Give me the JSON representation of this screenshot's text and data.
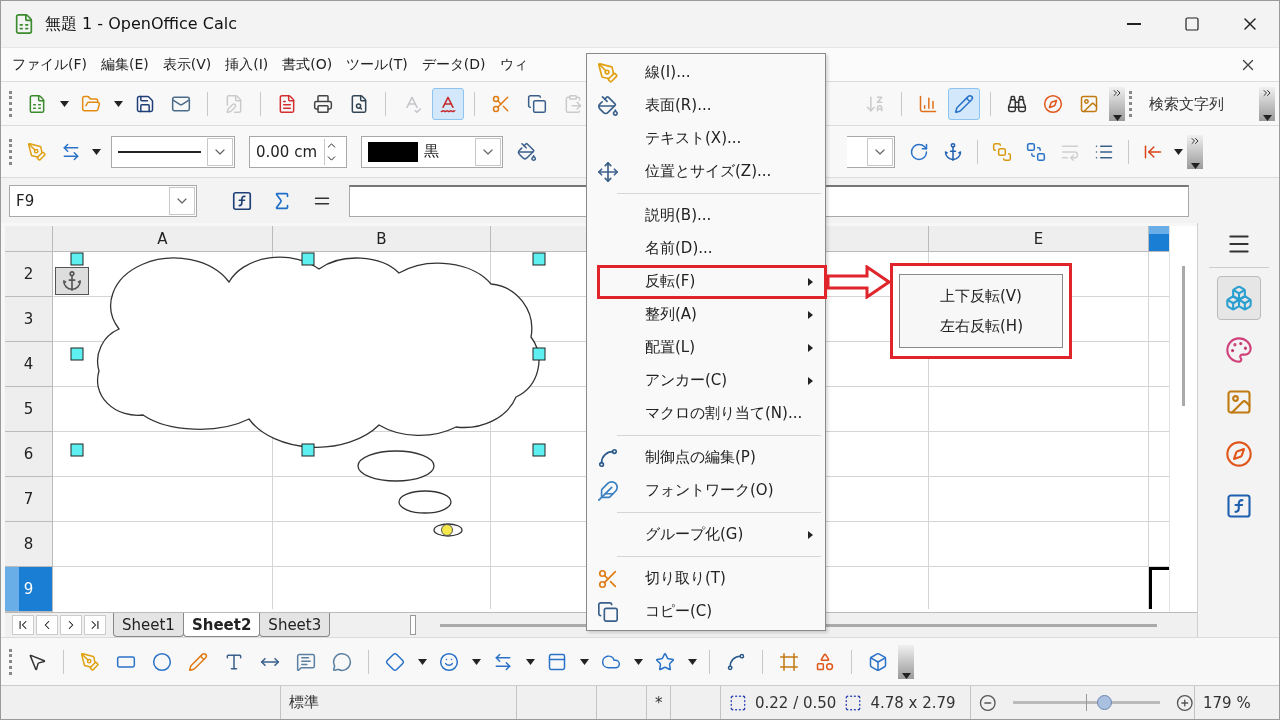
{
  "window": {
    "title": "無題 1 - OpenOffice Calc"
  },
  "menu_bar": [
    "ファイル(F)",
    "編集(E)",
    "表示(V)",
    "挿入(I)",
    "書式(O)",
    "ツール(T)",
    "データ(D)",
    "ウィ"
  ],
  "standard_toolbar": {
    "left": [
      {
        "kind": "new",
        "menu": true,
        "disabled": false,
        "selected": false
      },
      {
        "kind": "open",
        "menu": true,
        "disabled": false,
        "selected": false
      },
      {
        "kind": "save",
        "menu": false,
        "disabled": false,
        "selected": false
      },
      {
        "kind": "email",
        "menu": false,
        "disabled": false,
        "selected": false
      },
      {
        "kind": "separator"
      },
      {
        "kind": "edit",
        "menu": false,
        "disabled": true,
        "selected": false
      },
      {
        "kind": "separator"
      },
      {
        "kind": "pdf",
        "menu": false,
        "disabled": false,
        "selected": false
      },
      {
        "kind": "print",
        "menu": false,
        "disabled": false,
        "selected": false
      },
      {
        "kind": "preview",
        "menu": false,
        "disabled": false,
        "selected": false
      },
      {
        "kind": "separator"
      },
      {
        "kind": "spelling",
        "menu": false,
        "disabled": true,
        "selected": false
      },
      {
        "kind": "autospell",
        "menu": false,
        "disabled": false,
        "selected": true
      },
      {
        "kind": "separator"
      },
      {
        "kind": "cut",
        "menu": false,
        "disabled": false,
        "selected": false
      },
      {
        "kind": "copy",
        "menu": false,
        "disabled": false,
        "selected": false
      },
      {
        "kind": "paste",
        "menu": false,
        "disabled": true,
        "selected": false
      }
    ],
    "right": [
      {
        "kind": "sort",
        "menu": false,
        "disabled": true,
        "selected": false
      },
      {
        "kind": "separator"
      },
      {
        "kind": "chart",
        "menu": false,
        "disabled": false,
        "selected": false
      },
      {
        "kind": "draw",
        "menu": false,
        "disabled": false,
        "selected": true
      },
      {
        "kind": "separator"
      },
      {
        "kind": "find",
        "menu": false,
        "disabled": false,
        "selected": false
      },
      {
        "kind": "navigator",
        "menu": false,
        "disabled": false,
        "selected": false
      },
      {
        "kind": "gallery",
        "menu": false,
        "disabled": false,
        "selected": false
      },
      {
        "kind": "overflow"
      }
    ],
    "search": {
      "placeholder": "検索文字列"
    }
  },
  "format_toolbar": {
    "left": [
      {
        "kind": "line",
        "menu": false,
        "disabled": false
      },
      {
        "kind": "arrow-style",
        "menu": true,
        "disabled": false
      },
      {
        "kind": "line-style-select"
      },
      {
        "kind": "width-spin",
        "value": "0.00 cm"
      },
      {
        "kind": "color-select",
        "color": "#000000",
        "label": "黒"
      },
      {
        "kind": "area",
        "menu": false,
        "disabled": false
      }
    ],
    "right": [
      {
        "kind": "select-tail"
      },
      {
        "kind": "rotate",
        "menu": false,
        "disabled": false
      },
      {
        "kind": "anchor",
        "menu": false,
        "disabled": false
      },
      {
        "kind": "separator"
      },
      {
        "kind": "front",
        "menu": false,
        "disabled": false
      },
      {
        "kind": "back",
        "menu": false,
        "disabled": false
      },
      {
        "kind": "wrap-off",
        "menu": false,
        "disabled": true
      },
      {
        "kind": "wrap",
        "menu": false,
        "disabled": false
      },
      {
        "kind": "separator"
      },
      {
        "kind": "align",
        "menu": true,
        "disabled": false
      },
      {
        "kind": "overflow"
      }
    ]
  },
  "formula_bar": {
    "name_box": "F9"
  },
  "sheet": {
    "columns": [
      {
        "label": "A",
        "selected": false
      },
      {
        "label": "B",
        "selected": false
      },
      {
        "selected": false
      },
      {
        "selected": false
      },
      {
        "label": "E",
        "selected": false
      },
      {
        "selected": true
      }
    ],
    "rows": [
      {
        "label": "2",
        "selected": false
      },
      {
        "label": "3",
        "selected": false
      },
      {
        "label": "4",
        "selected": false
      },
      {
        "label": "5",
        "selected": false
      },
      {
        "label": "6",
        "selected": false
      },
      {
        "label": "7",
        "selected": false
      },
      {
        "label": "8",
        "selected": false
      },
      {
        "label": "9",
        "selected": true
      }
    ],
    "tabs": [
      {
        "label": "Sheet1",
        "selected": false
      },
      {
        "label": "Sheet2",
        "selected": true
      },
      {
        "label": "Sheet3",
        "selected": false
      }
    ]
  },
  "sidebar": {
    "items": [
      {
        "kind": "properties",
        "selected": true
      },
      {
        "kind": "styles",
        "selected": false
      },
      {
        "kind": "gallery",
        "selected": false
      },
      {
        "kind": "navigator",
        "selected": false
      },
      {
        "kind": "functions",
        "selected": false
      }
    ]
  },
  "drawing_toolbar": [
    {
      "kind": "select",
      "menu": false
    },
    {
      "kind": "separator"
    },
    {
      "kind": "line",
      "menu": false
    },
    {
      "kind": "rectangle",
      "menu": false
    },
    {
      "kind": "ellipse",
      "menu": false
    },
    {
      "kind": "freeform",
      "menu": false
    },
    {
      "kind": "text",
      "menu": false
    },
    {
      "kind": "dimension",
      "menu": false
    },
    {
      "kind": "callout",
      "menu": false
    },
    {
      "kind": "vertical-callout",
      "menu": false
    },
    {
      "kind": "separator"
    },
    {
      "kind": "basic-shapes",
      "menu": true
    },
    {
      "kind": "symbol-shapes",
      "menu": true
    },
    {
      "kind": "block-arrows",
      "menu": true
    },
    {
      "kind": "flowchart",
      "menu": true
    },
    {
      "kind": "callouts",
      "menu": true
    },
    {
      "kind": "stars",
      "menu": true
    },
    {
      "kind": "separator"
    },
    {
      "kind": "points",
      "menu": false
    },
    {
      "kind": "separator"
    },
    {
      "kind": "fontwork",
      "menu": false
    },
    {
      "kind": "insert-shape",
      "menu": false
    },
    {
      "kind": "separator"
    },
    {
      "kind": "extrusion",
      "menu": false
    },
    {
      "kind": "overflow"
    }
  ],
  "status_bar": {
    "style": "標準",
    "modified": "*",
    "position": "0.22 / 0.50",
    "size": "4.78 x 2.79",
    "zoom": {
      "level": 0.62
    },
    "zoom_value": "179 %"
  },
  "context_menu": [
    {
      "kind": "line",
      "label": "線(I)...",
      "submenu": false,
      "highlighted": false
    },
    {
      "kind": "area",
      "label": "表面(R)...",
      "submenu": false,
      "highlighted": false
    },
    {
      "kind": "text",
      "label": "テキスト(X)...",
      "submenu": false,
      "highlighted": false
    },
    {
      "kind": "position",
      "label": "位置とサイズ(Z)...",
      "submenu": false,
      "highlighted": false
    },
    {
      "kind": "separator"
    },
    {
      "kind": "description",
      "label": "説明(B)...",
      "submenu": false,
      "highlighted": false
    },
    {
      "kind": "name",
      "label": "名前(D)...",
      "submenu": false,
      "highlighted": false
    },
    {
      "kind": "flip",
      "label": "反転(F)",
      "submenu": true,
      "highlighted": true
    },
    {
      "kind": "arrange",
      "label": "整列(A)",
      "submenu": true,
      "highlighted": false
    },
    {
      "kind": "alignment",
      "label": "配置(L)",
      "submenu": true,
      "highlighted": false
    },
    {
      "kind": "anchor",
      "label": "アンカー(C)",
      "submenu": true,
      "highlighted": false
    },
    {
      "kind": "macro",
      "label": "マクロの割り当て(N)...",
      "submenu": false,
      "highlighted": false
    },
    {
      "kind": "separator"
    },
    {
      "kind": "points",
      "label": "制御点の編集(P)",
      "submenu": false,
      "highlighted": false
    },
    {
      "kind": "fontwork",
      "label": "フォントワーク(O)",
      "submenu": false,
      "highlighted": false
    },
    {
      "kind": "separator"
    },
    {
      "kind": "group",
      "label": "グループ化(G)",
      "submenu": true,
      "highlighted": false
    },
    {
      "kind": "separator"
    },
    {
      "kind": "cut",
      "label": "切り取り(T)",
      "submenu": false,
      "highlighted": false
    },
    {
      "kind": "copy",
      "label": "コピー(C)",
      "submenu": false,
      "highlighted": false
    }
  ],
  "submenu": [
    "上下反転(V)",
    "左右反転(H)"
  ]
}
